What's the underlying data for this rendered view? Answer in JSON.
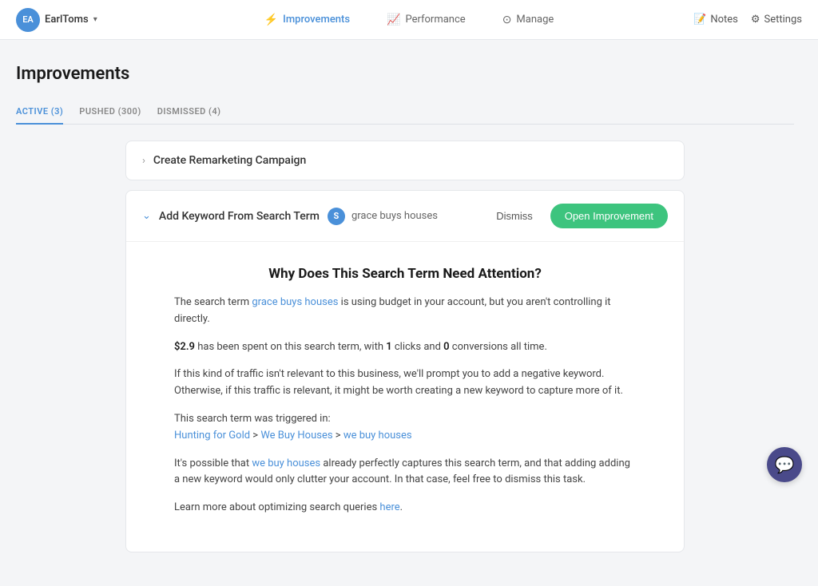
{
  "topnav": {
    "avatar_initials": "EA",
    "account_name": "EarlToms",
    "nav_items": [
      {
        "label": "Improvements",
        "active": true,
        "icon": "⚡"
      },
      {
        "label": "Performance",
        "active": false,
        "icon": "📈"
      },
      {
        "label": "Manage",
        "active": false,
        "icon": "⊙"
      }
    ],
    "right_items": [
      {
        "label": "Notes",
        "icon": "📝"
      },
      {
        "label": "Settings",
        "icon": "⚙"
      }
    ]
  },
  "page": {
    "title": "Improvements",
    "tabs": [
      {
        "label": "ACTIVE (3)",
        "active": true
      },
      {
        "label": "PUSHED (300)",
        "active": false
      },
      {
        "label": "DISMISSED (4)",
        "active": false
      }
    ]
  },
  "cards": [
    {
      "id": "remarketing",
      "title": "Create Remarketing Campaign",
      "expanded": false
    }
  ],
  "expanded_card": {
    "title": "Add Keyword From Search Term",
    "badge": "S",
    "search_term": "grace buys houses",
    "dismiss_label": "Dismiss",
    "open_label": "Open Improvement",
    "section_title": "Why Does This Search Term Need Attention?",
    "paragraphs": {
      "p1_before": "The search term ",
      "p1_link": "grace buys houses",
      "p1_after": " is using budget in your account, but you aren't controlling it directly.",
      "p2_bold1": "$2.9",
      "p2_mid1": " has been spent on this search term, with ",
      "p2_bold2": "1",
      "p2_mid2": " clicks and ",
      "p2_bold3": "0",
      "p2_after": " conversions all time.",
      "p3": "If this kind of traffic isn't relevant to this business, we'll prompt you to add a negative keyword. Otherwise, if this traffic is relevant, it might be worth creating a new keyword to capture more of it.",
      "p4_before": "This search term was triggered in:",
      "p4_link1": "Hunting for Gold",
      "p4_sep1": " > ",
      "p4_link2": "We Buy Houses",
      "p4_sep2": " > ",
      "p4_link3": "we buy houses",
      "p5_before": "It's possible that ",
      "p5_link": "we buy houses",
      "p5_after": " already perfectly captures this search term, and that adding adding a new keyword would only clutter your account. In that case, feel free to dismiss this task.",
      "p6_before": "Learn more about optimizing search queries ",
      "p6_link": "here",
      "p6_after": "."
    }
  }
}
